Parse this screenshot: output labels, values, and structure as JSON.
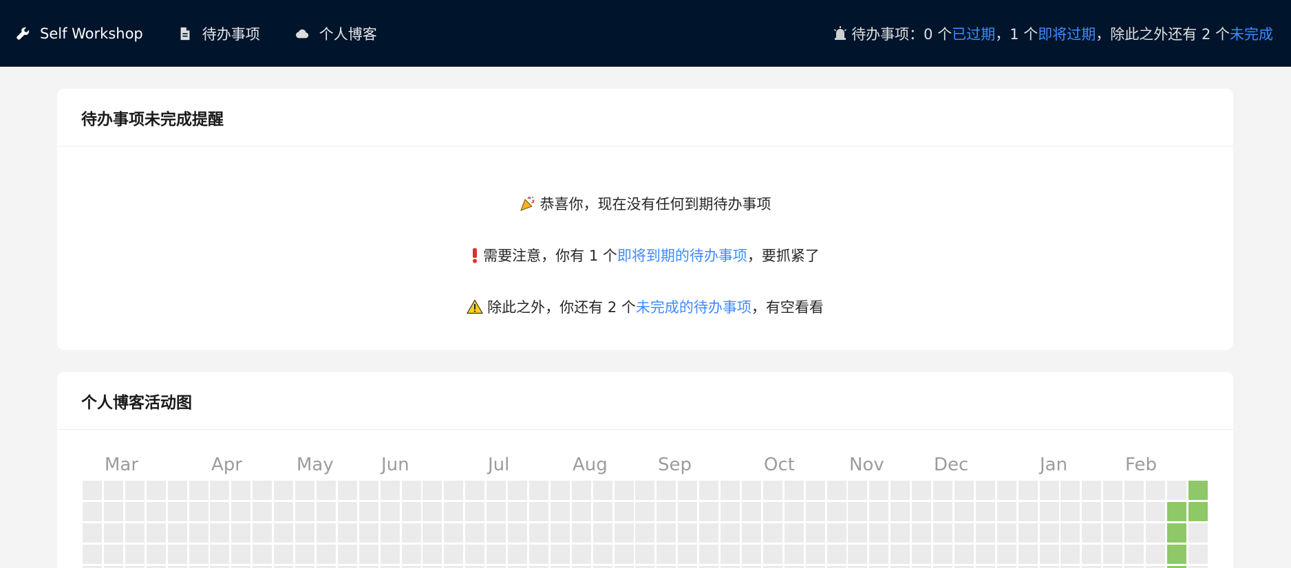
{
  "navbar": {
    "brand": "Self Workshop",
    "items": [
      {
        "label": "待办事项",
        "icon": "document-icon"
      },
      {
        "label": "个人博客",
        "icon": "cloud-icon"
      }
    ],
    "status": {
      "icon": "alarm-icon",
      "prefix": "待办事项：0 个",
      "expired_link": "已过期",
      "mid": "，1 个",
      "soon_link": "即将过期",
      "suffix": "，除此之外还有 2 个",
      "unfinished_link": "未完成"
    }
  },
  "reminder_card": {
    "title": "待办事项未完成提醒",
    "line1": {
      "icon": "party-popper-icon",
      "text": "恭喜你，现在没有任何到期待办事项"
    },
    "line2": {
      "icon": "exclamation-icon",
      "before": "需要注意，你有 1 个",
      "link": "即将到期的待办事项",
      "after": "，要抓紧了"
    },
    "line3": {
      "icon": "warning-icon",
      "before": "除此之外，你还有 2 个",
      "link": "未完成的待办事项",
      "after": "，有空看看"
    }
  },
  "activity_card": {
    "title": "个人博客活动图",
    "months": [
      "Mar",
      "Apr",
      "May",
      "Jun",
      "Jul",
      "Aug",
      "Sep",
      "Oct",
      "Nov",
      "Dec",
      "Jan",
      "Feb"
    ],
    "weeks": 53,
    "active": [
      [
        52,
        0
      ],
      [
        51,
        1
      ],
      [
        52,
        1
      ],
      [
        51,
        2
      ],
      [
        51,
        3
      ],
      [
        51,
        4
      ]
    ]
  },
  "colors": {
    "navbar_bg": "#00142b",
    "link": "#3d8bff",
    "cell_empty": "#ebebeb",
    "cell_active": "#8fc866"
  }
}
